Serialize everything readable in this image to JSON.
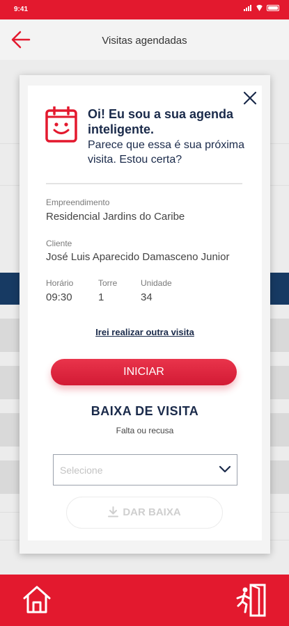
{
  "status_bar": {
    "time": "9:41"
  },
  "header": {
    "title": "Visitas agendadas"
  },
  "assistant": {
    "greeting": "Oi! Eu sou a sua agenda inteligente.",
    "question": "Parece que essa é sua próxima visita. Estou certa?"
  },
  "visit": {
    "empreendimento_label": "Empreendimento",
    "empreendimento_value": "Residencial Jardins do Caribe",
    "cliente_label": "Cliente",
    "cliente_value": "José Luis Aparecido Damasceno Junior",
    "horario_label": "Horário",
    "horario_value": "09:30",
    "torre_label": "Torre",
    "torre_value": "1",
    "unidade_label": "Unidade",
    "unidade_value": "34"
  },
  "actions": {
    "other_visit_link": "Irei realizar outra visita",
    "start_button": "INICIAR"
  },
  "baixa": {
    "title": "BAIXA DE VISITA",
    "subtitle": "Falta ou recusa",
    "select_placeholder": "Selecione",
    "submit_button": "DAR BAIXA"
  },
  "icons": {
    "back": "arrow-left-icon",
    "close": "close-icon",
    "assistant": "smiling-calendar-icon",
    "select": "chevron-down-icon",
    "submit": "download-icon",
    "home": "home-icon",
    "exit": "exit-door-icon"
  },
  "colors": {
    "brand_red": "#e3192e",
    "navy": "#1a2a4a",
    "dark_blue_strip": "#173a63"
  }
}
